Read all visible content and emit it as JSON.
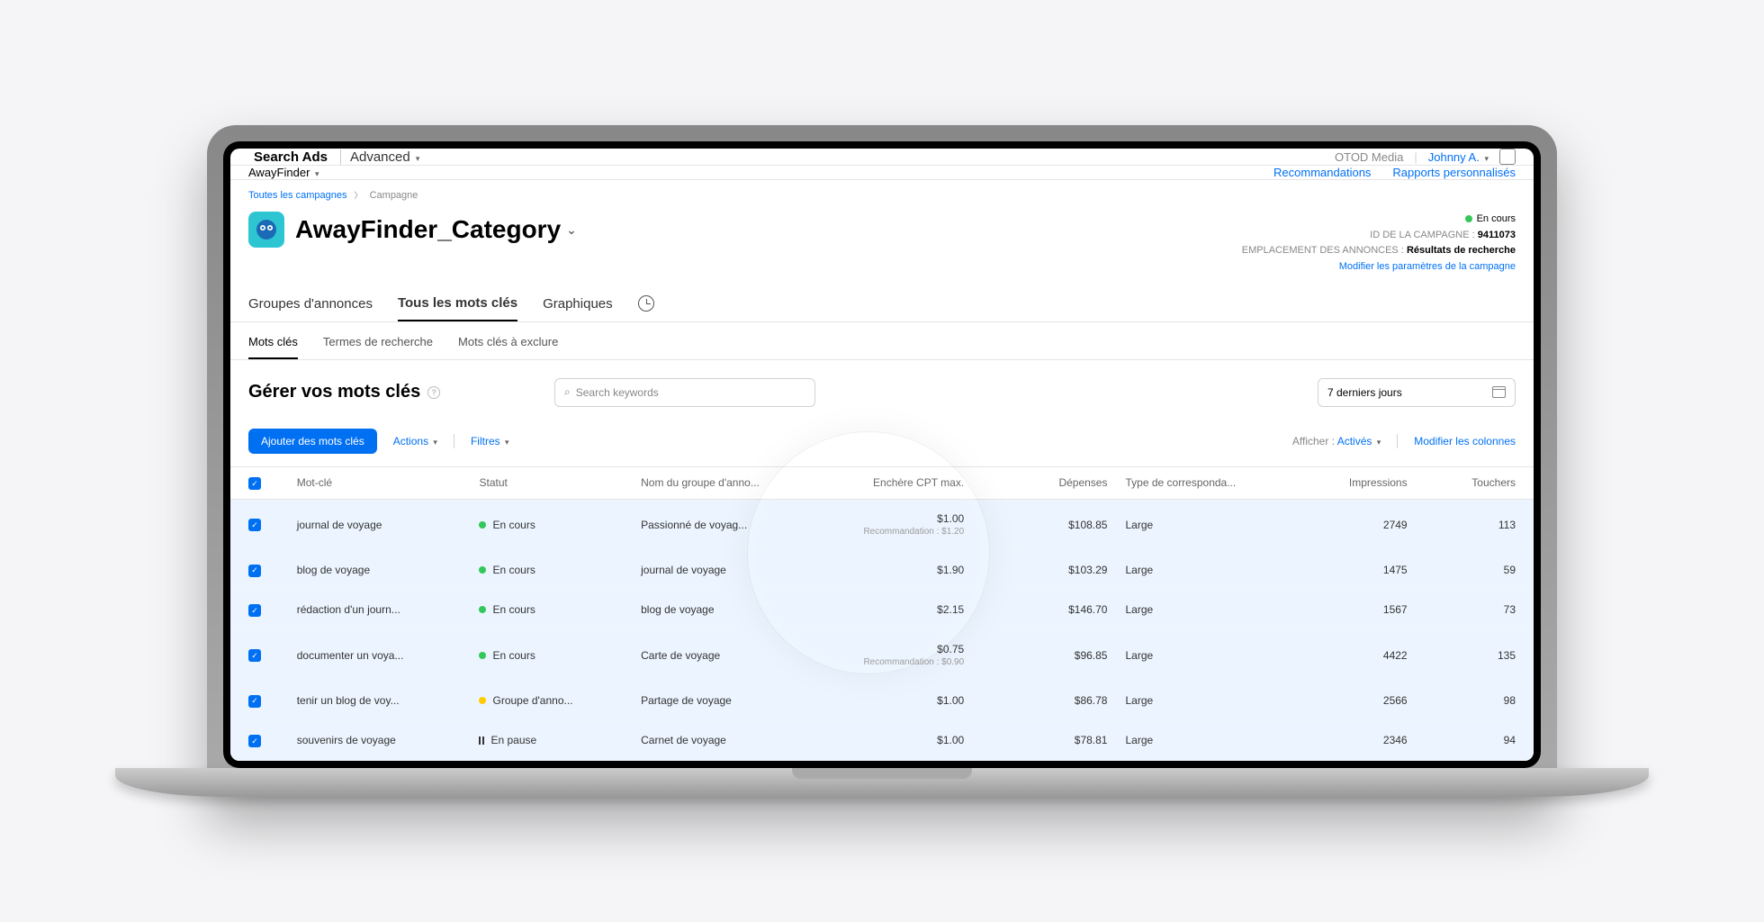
{
  "topbar": {
    "brand_main": "Search Ads",
    "brand_sub": "Advanced",
    "org": "OTOD Media",
    "user": "Johnny A."
  },
  "subbar": {
    "app": "AwayFinder",
    "link1": "Recommandations",
    "link2": "Rapports personnalisés"
  },
  "breadcrumb": {
    "all": "Toutes les campagnes",
    "current": "Campagne"
  },
  "header": {
    "title": "AwayFinder_Category",
    "status": "En cours",
    "id_label": "ID DE LA CAMPAGNE :",
    "id_value": "9411073",
    "placement_label": "EMPLACEMENT DES ANNONCES :",
    "placement_value": "Résultats de recherche",
    "edit_link": "Modifier les paramètres de la campagne"
  },
  "tabs_main": {
    "t1": "Groupes d'annonces",
    "t2": "Tous les mots clés",
    "t3": "Graphiques"
  },
  "tabs_sub": {
    "t1": "Mots clés",
    "t2": "Termes de recherche",
    "t3": "Mots clés à exclure"
  },
  "manage": {
    "title": "Gérer vos mots clés",
    "search_placeholder": "Search keywords",
    "date_range": "7 derniers jours"
  },
  "actions": {
    "add": "Ajouter des mots clés",
    "actions": "Actions",
    "filters": "Filtres",
    "show_label": "Afficher :",
    "show_value": "Activés",
    "edit_cols": "Modifier les colonnes"
  },
  "columns": {
    "keyword": "Mot-clé",
    "status": "Statut",
    "group": "Nom du groupe d'anno...",
    "bid": "Enchère CPT max.",
    "spend": "Dépenses",
    "match": "Type de corresponda...",
    "impressions": "Impressions",
    "taps": "Touchers"
  },
  "status_labels": {
    "running": "En cours",
    "group": "Groupe d'anno...",
    "paused": "En pause"
  },
  "recommendation_prefix": "Recommandation :",
  "rows": [
    {
      "kw": "journal de voyage",
      "status": "running",
      "group": "Passionné de voyag...",
      "bid": "$1.00",
      "rec": "$1.20",
      "spend": "$108.85",
      "match": "Large",
      "imp": "2749",
      "taps": "113"
    },
    {
      "kw": "blog de voyage",
      "status": "running",
      "group": "journal de voyage",
      "bid": "$1.90",
      "rec": "",
      "spend": "$103.29",
      "match": "Large",
      "imp": "1475",
      "taps": "59"
    },
    {
      "kw": "rédaction d'un journ...",
      "status": "running",
      "group": "blog de voyage",
      "bid": "$2.15",
      "rec": "",
      "spend": "$146.70",
      "match": "Large",
      "imp": "1567",
      "taps": "73"
    },
    {
      "kw": "documenter un voya...",
      "status": "running",
      "group": "Carte de voyage",
      "bid": "$0.75",
      "rec": "$0.90",
      "spend": "$96.85",
      "match": "Large",
      "imp": "4422",
      "taps": "135"
    },
    {
      "kw": "tenir un blog de voy...",
      "status": "group",
      "group": "Partage de voyage",
      "bid": "$1.00",
      "rec": "",
      "spend": "$86.78",
      "match": "Large",
      "imp": "2566",
      "taps": "98"
    },
    {
      "kw": "souvenirs de voyage",
      "status": "paused",
      "group": "Carnet de voyage",
      "bid": "$1.00",
      "rec": "",
      "spend": "$78.81",
      "match": "Large",
      "imp": "2346",
      "taps": "94"
    }
  ]
}
